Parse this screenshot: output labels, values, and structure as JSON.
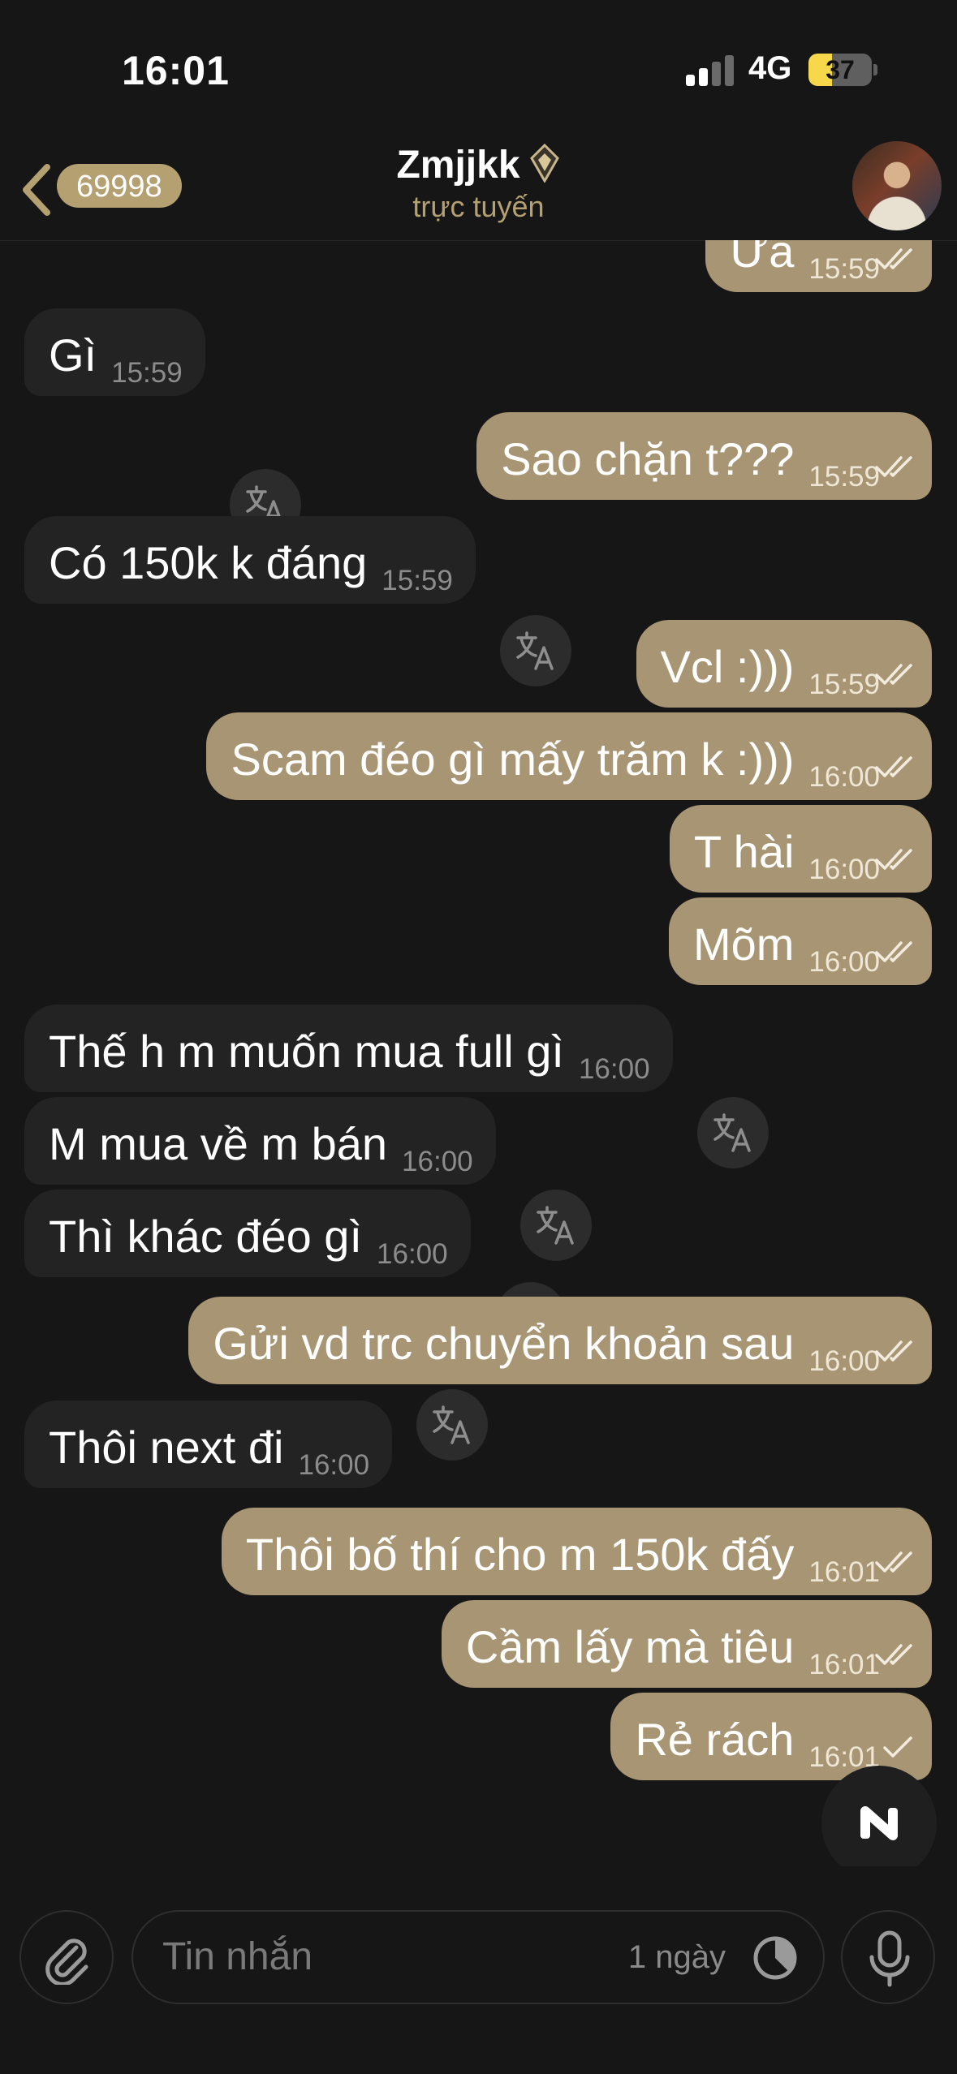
{
  "status_bar": {
    "time": "16:01",
    "network": "4G",
    "battery": "37",
    "battery_fraction": 0.37
  },
  "header": {
    "unread_count": "69998",
    "title": "Zmjjkk",
    "presence": "trực tuyến"
  },
  "messages": [
    {
      "dir": "out",
      "text": "Ừa",
      "time": "15:59",
      "ticks": "read"
    },
    {
      "dir": "in",
      "text": "Gì",
      "time": "15:59"
    },
    {
      "dir": "out",
      "text": "Sao chặn t???",
      "time": "15:59",
      "ticks": "read"
    },
    {
      "dir": "in",
      "text": "Có 150k k đáng",
      "time": "15:59"
    },
    {
      "dir": "out",
      "text": "Vcl :)))",
      "time": "15:59",
      "ticks": "read"
    },
    {
      "dir": "out",
      "text": "Scam đéo gì mấy trăm k :)))",
      "time": "16:00",
      "ticks": "read"
    },
    {
      "dir": "out",
      "text": "T hài",
      "time": "16:00",
      "ticks": "read"
    },
    {
      "dir": "out",
      "text": "Mõm",
      "time": "16:00",
      "ticks": "read"
    },
    {
      "dir": "in",
      "text": "Thế h m muốn mua full gì",
      "time": "16:00"
    },
    {
      "dir": "in",
      "text": "M mua về m bán",
      "time": "16:00"
    },
    {
      "dir": "in",
      "text": "Thì khác đéo gì",
      "time": "16:00"
    },
    {
      "dir": "out",
      "text": "Gửi vd trc chuyển khoản sau",
      "time": "16:00",
      "ticks": "read"
    },
    {
      "dir": "in",
      "text": "Thôi next đi",
      "time": "16:00"
    },
    {
      "dir": "out",
      "text": "Thôi bố thí cho m 150k đấy",
      "time": "16:01",
      "ticks": "read"
    },
    {
      "dir": "out",
      "text": "Cầm lấy mà tiêu",
      "time": "16:01",
      "ticks": "read"
    },
    {
      "dir": "out",
      "text": "Rẻ rách",
      "time": "16:01",
      "ticks": "sent"
    }
  ],
  "composer": {
    "placeholder": "Tin nhắn",
    "timer": "1 ngày"
  },
  "icons": {
    "back": "chevron-left-icon",
    "badge": "gold-rank-badge-icon",
    "translate": "translate-icon",
    "fab": "app-logo-icon",
    "attach": "paperclip-icon",
    "timer": "timer-icon",
    "mic": "microphone-icon",
    "ticks_read": "double-check-icon",
    "ticks_sent": "check-icon"
  },
  "colors": {
    "background": "#161616",
    "incoming_bubble": "#232323",
    "outgoing_bubble": "#a89573",
    "accent": "#b5a072",
    "battery": "#f6d84a"
  }
}
